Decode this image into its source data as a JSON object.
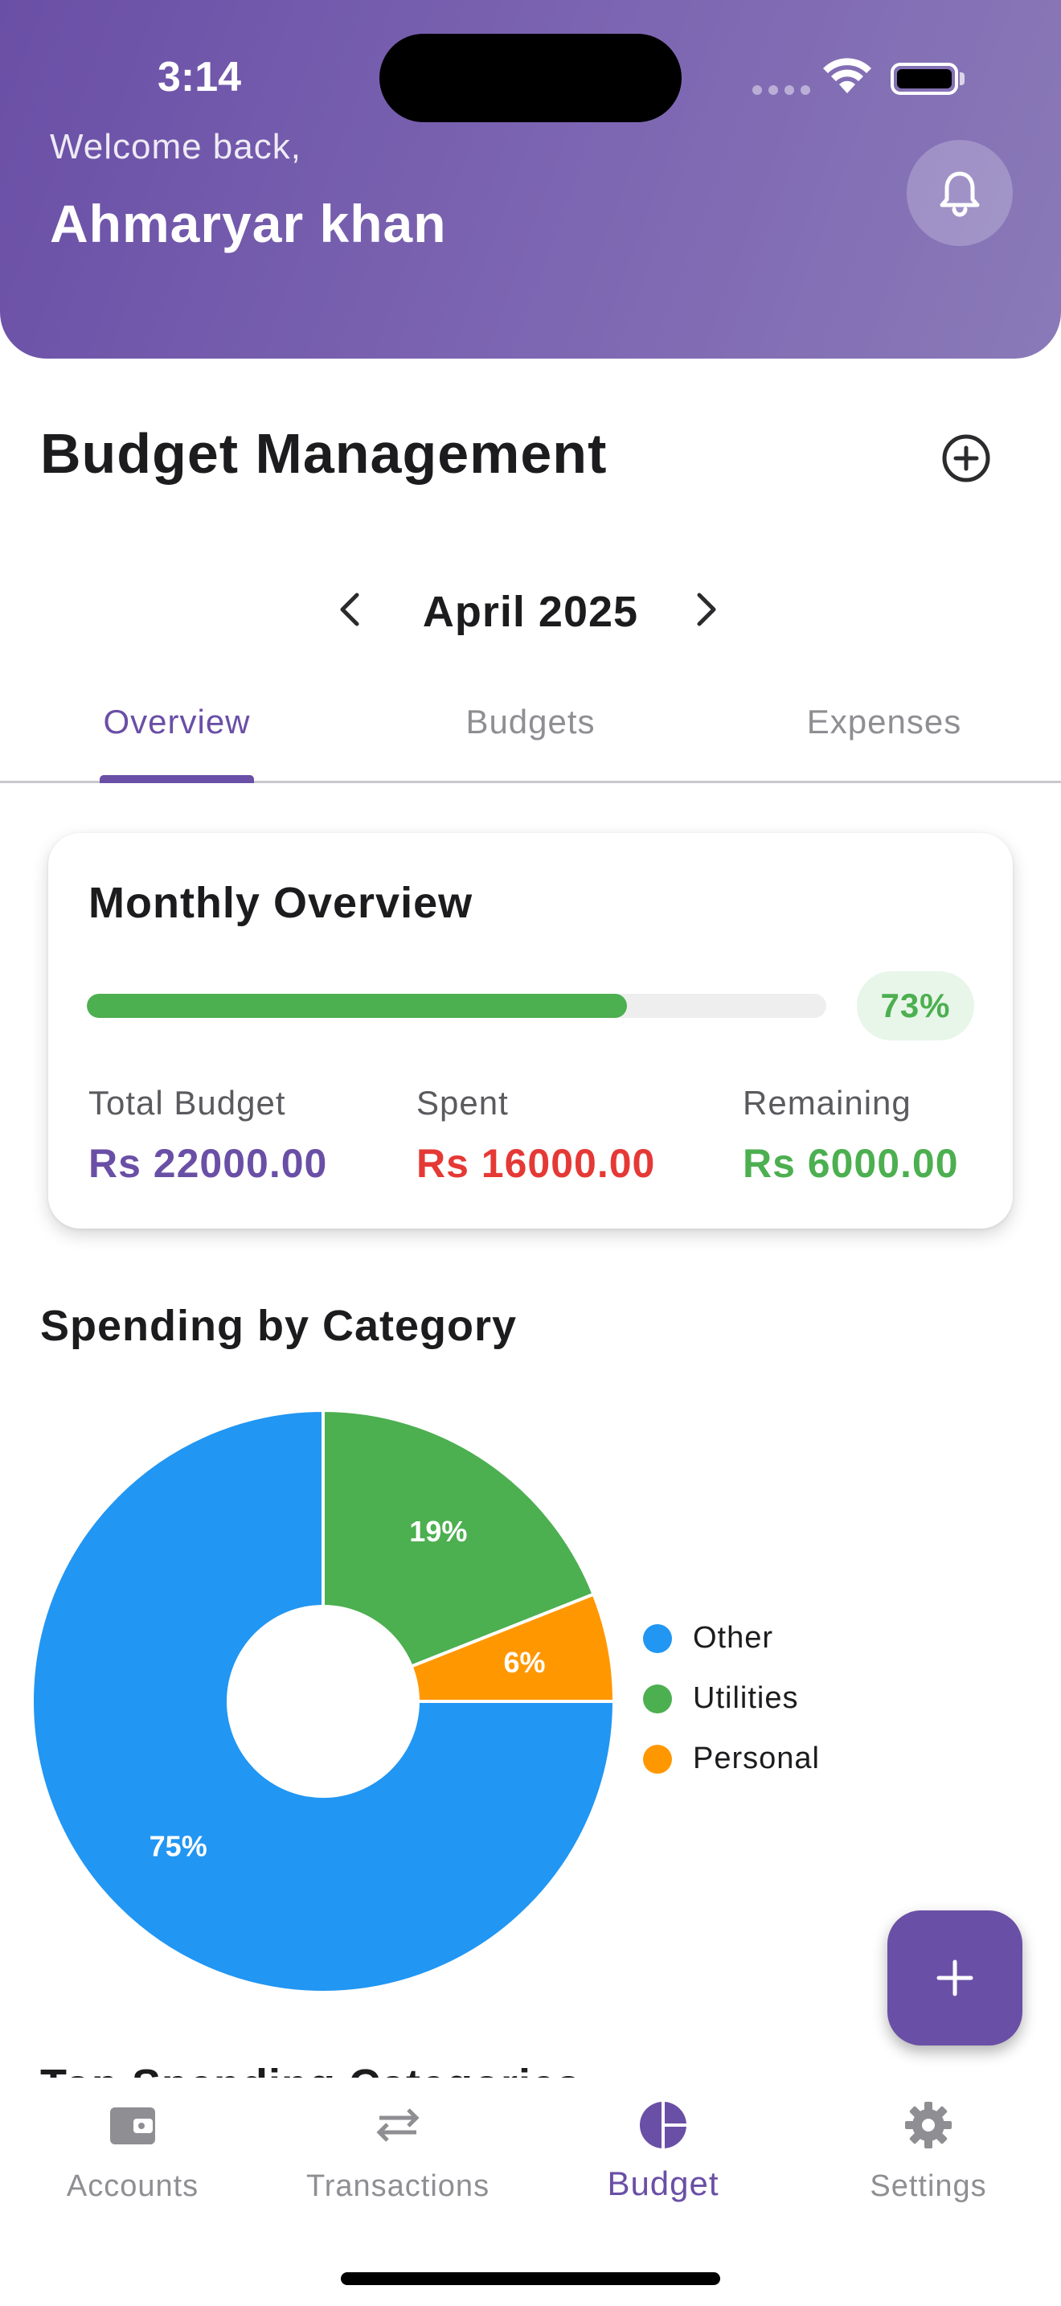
{
  "status_bar": {
    "time": "3:14"
  },
  "header": {
    "welcome": "Welcome back,",
    "user_name": "Ahmaryar khan",
    "notification_icon": "bell-icon"
  },
  "page": {
    "title": "Budget Management",
    "add_icon": "plus-circle-icon"
  },
  "month_nav": {
    "label": "April 2025",
    "prev_icon": "chevron-left-icon",
    "next_icon": "chevron-right-icon"
  },
  "tabs": [
    {
      "label": "Overview",
      "active": true
    },
    {
      "label": "Budgets",
      "active": false
    },
    {
      "label": "Expenses",
      "active": false
    }
  ],
  "overview": {
    "title": "Monthly Overview",
    "progress": 0.73,
    "percent_label": "73%",
    "stats": [
      {
        "label": "Total Budget",
        "value": "Rs 22000.00",
        "color": "#6a4fa6"
      },
      {
        "label": "Spent",
        "value": "Rs 16000.00",
        "color": "#e53935"
      },
      {
        "label": "Remaining",
        "value": "Rs 6000.00",
        "color": "#4caf50"
      }
    ]
  },
  "spending": {
    "title": "Spending by Category",
    "chart_data": {
      "type": "pie",
      "categories": [
        "Utilities",
        "Personal",
        "Other"
      ],
      "values": [
        19,
        6,
        75
      ],
      "labels": [
        "19%",
        "6%",
        "75%"
      ],
      "colors": [
        "#4caf50",
        "#ff9800",
        "#2196f3"
      ],
      "donut": true,
      "legend": [
        {
          "label": "Other",
          "color": "#2196f3"
        },
        {
          "label": "Utilities",
          "color": "#4caf50"
        },
        {
          "label": "Personal",
          "color": "#ff9800"
        }
      ],
      "legend_position": "right"
    }
  },
  "next_section": {
    "title": "Top Spending Categories"
  },
  "fab": {
    "icon": "plus-icon"
  },
  "bottom_nav": [
    {
      "label": "Accounts",
      "icon": "wallet-icon",
      "active": false
    },
    {
      "label": "Transactions",
      "icon": "swap-arrows-icon",
      "active": false
    },
    {
      "label": "Budget",
      "icon": "pie-chart-icon",
      "active": true
    },
    {
      "label": "Settings",
      "icon": "gear-icon",
      "active": false
    }
  ]
}
